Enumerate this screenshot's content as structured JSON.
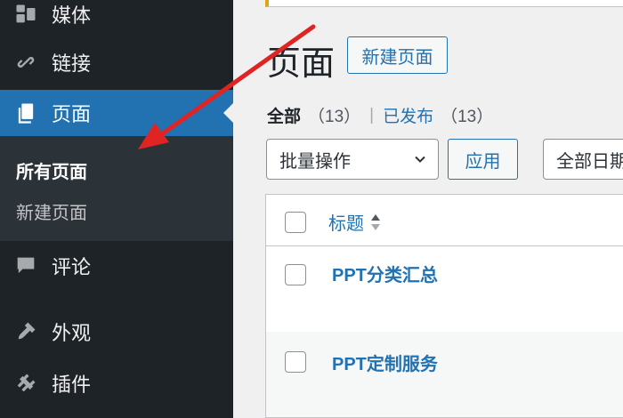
{
  "sidebar": {
    "items": [
      {
        "label": "媒体",
        "icon": "media-icon"
      },
      {
        "label": "链接",
        "icon": "link-icon"
      },
      {
        "label": "页面",
        "icon": "pages-icon"
      },
      {
        "label": "评论",
        "icon": "comments-icon"
      },
      {
        "label": "外观",
        "icon": "appearance-icon"
      },
      {
        "label": "插件",
        "icon": "plugins-icon"
      }
    ],
    "submenu": [
      {
        "label": "所有页面"
      },
      {
        "label": "新建页面"
      }
    ],
    "colors": {
      "bg": "#1d2327",
      "active": "#2271b1",
      "submenu_bg": "#2c3338"
    }
  },
  "main": {
    "title": "页面",
    "add_new_label": "新建页面",
    "filters": {
      "all_label": "全部",
      "all_count": "（13）",
      "separator": "|",
      "published_label": "已发布",
      "published_count": "（13）"
    },
    "bulk_actions": {
      "selected": "批量操作"
    },
    "apply_label": "应用",
    "date_filter": {
      "selected": "全部日期"
    },
    "table": {
      "columns": [
        "标题"
      ],
      "rows": [
        {
          "title": "PPT分类汇总"
        },
        {
          "title": "PPT定制服务"
        }
      ]
    }
  },
  "annotation": {
    "arrow_color": "#e02424"
  }
}
